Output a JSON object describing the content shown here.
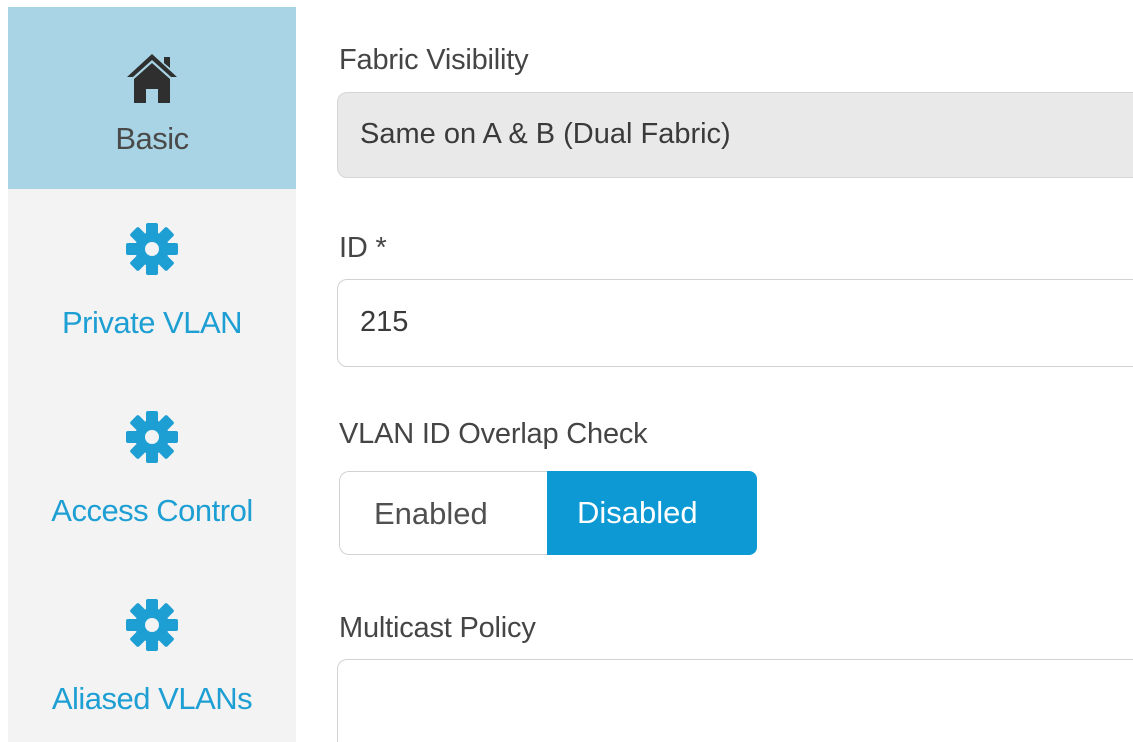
{
  "sidebar": {
    "items": [
      {
        "label": "Basic",
        "icon": "home-icon",
        "active": true
      },
      {
        "label": "Private VLAN",
        "icon": "gear-icon",
        "active": false
      },
      {
        "label": "Access Control",
        "icon": "gear-icon",
        "active": false
      },
      {
        "label": "Aliased VLANs",
        "icon": "gear-icon",
        "active": false
      }
    ]
  },
  "form": {
    "fabric_visibility": {
      "label": "Fabric Visibility",
      "value": "Same on A & B (Dual Fabric)"
    },
    "id": {
      "label": "ID *",
      "value": "215"
    },
    "overlap_check": {
      "label": "VLAN ID Overlap Check",
      "options": [
        "Enabled",
        "Disabled"
      ],
      "selected": "Disabled"
    },
    "multicast_policy": {
      "label": "Multicast Policy",
      "value": ""
    }
  },
  "colors": {
    "accent": "#0c99d4",
    "link": "#1e9fd4",
    "active_nav_bg": "#a9d4e5",
    "sidebar_bg": "#f3f3f3"
  }
}
